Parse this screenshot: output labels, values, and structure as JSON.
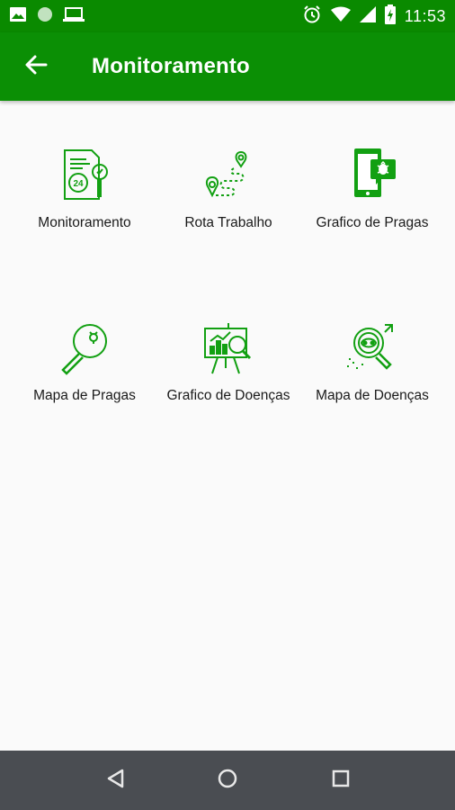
{
  "status_bar": {
    "time": "11:53",
    "left_icons": [
      "image-icon",
      "circle-icon",
      "laptop-icon"
    ],
    "right_icons": [
      "alarm-icon",
      "wifi-icon",
      "signal-icon",
      "battery-charging-icon"
    ]
  },
  "app_bar": {
    "title": "Monitoramento",
    "back_icon": "arrow-left-icon",
    "color": "#0b8f05"
  },
  "tiles": [
    {
      "label": "Monitoramento",
      "icon": "monitoring-document-icon"
    },
    {
      "label": "Rota Trabalho",
      "icon": "route-map-icon"
    },
    {
      "label": "Grafico de Pragas",
      "icon": "tablet-bug-icon"
    },
    {
      "label": "Mapa de Pragas",
      "icon": "magnifier-pest-icon"
    },
    {
      "label": "Grafico de Doenças",
      "icon": "chart-board-magnifier-icon"
    },
    {
      "label": "Mapa de Doenças",
      "icon": "magnifier-disease-icon"
    }
  ],
  "nav_bar": {
    "buttons": [
      "back-triangle-icon",
      "home-circle-icon",
      "recents-square-icon"
    ]
  },
  "accent_color": "#12a012"
}
